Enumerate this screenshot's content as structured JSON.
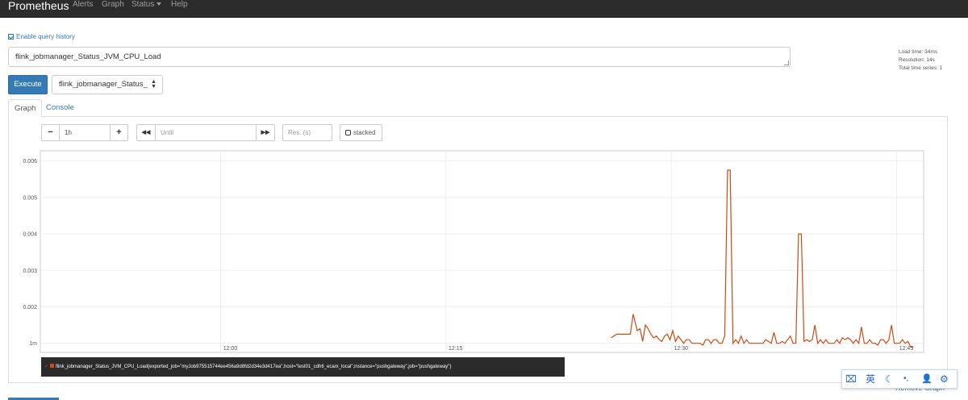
{
  "navbar": {
    "brand": "Prometheus",
    "items": [
      {
        "label": "Alerts"
      },
      {
        "label": "Graph"
      },
      {
        "label": "Status"
      },
      {
        "label": "Help"
      }
    ]
  },
  "history": {
    "label": "Enable query history"
  },
  "query": {
    "value": "flink_jobmanager_Status_JVM_CPU_Load"
  },
  "stats": {
    "load_time": "Load time: 34ms",
    "resolution": "Resolution: 14s",
    "total_series": "Total time series: 1"
  },
  "execute": {
    "label": "Execute"
  },
  "metric_select": {
    "value": "flink_jobmanager_Status_"
  },
  "tabs": [
    {
      "label": "Graph"
    },
    {
      "label": "Console"
    }
  ],
  "controls": {
    "minus": "−",
    "range": "1h",
    "plus": "+",
    "back": "◀◀",
    "until_placeholder": "Until",
    "forward": "▶▶",
    "res_placeholder": "Res. (s)",
    "stacked": "stacked"
  },
  "legend": {
    "series": "flink_jobmanager_Status_JVM_CPU_Load{exported_job=\"myJob975515744ee456a9d8fd2d34e3d417ea\",host=\"test01_cdh6_ecarx_local\",instance=\"pushgateway\",job=\"pushgateway\"}"
  },
  "remove_graph": "Remove Graph",
  "ime": {
    "lang": "英",
    "items": [
      "⌧",
      "☾",
      "•,",
      "👤",
      "⚙"
    ]
  },
  "colors": {
    "series": "#cb4b16",
    "accent": "#337ab7",
    "navbar": "#2c2c2c"
  },
  "chart_data": {
    "type": "line",
    "yticks": [
      {
        "label": "1m",
        "value": 0.001
      },
      {
        "label": "0.002",
        "value": 0.002
      },
      {
        "label": "0.003",
        "value": 0.003
      },
      {
        "label": "0.004",
        "value": 0.004
      },
      {
        "label": "0.005",
        "value": 0.005
      },
      {
        "label": "0.006",
        "value": 0.006
      }
    ],
    "xticks": [
      {
        "label": "12:00",
        "t": 12.0
      },
      {
        "label": "12:15",
        "t": 12.25
      },
      {
        "label": "12:30",
        "t": 12.5
      },
      {
        "label": "12:45",
        "t": 12.75
      }
    ],
    "xlim": [
      11.8,
      12.78
    ],
    "ylim": [
      0.00075,
      0.00628
    ],
    "series": [
      {
        "color": "#cb4b16",
        "points": [
          [
            12.4333,
            0.00115
          ],
          [
            12.4395,
            0.00125
          ],
          [
            12.4486,
            0.00125
          ],
          [
            12.4546,
            0.00125
          ],
          [
            12.4577,
            0.0018
          ],
          [
            12.4622,
            0.00135
          ],
          [
            12.4653,
            0.0014
          ],
          [
            12.4683,
            0.00105
          ],
          [
            12.4713,
            0.0015
          ],
          [
            12.4744,
            0.0014
          ],
          [
            12.4774,
            0.00125
          ],
          [
            12.4804,
            0.00115
          ],
          [
            12.4835,
            0.0012
          ],
          [
            12.4865,
            0.0011
          ],
          [
            12.4895,
            0.00105
          ],
          [
            12.4926,
            0.0012
          ],
          [
            12.4956,
            0.00125
          ],
          [
            12.4986,
            0.0011
          ],
          [
            12.5017,
            0.00135
          ],
          [
            12.5047,
            0.00105
          ],
          [
            12.5077,
            0.0012
          ],
          [
            12.5108,
            0.0011
          ],
          [
            12.5138,
            0.001
          ],
          [
            12.5168,
            0.0011
          ],
          [
            12.5199,
            0.0011
          ],
          [
            12.5229,
            0.001
          ],
          [
            12.526,
            0.001
          ],
          [
            12.529,
            0.001
          ],
          [
            12.532,
            0.001
          ],
          [
            12.5351,
            0.00095
          ],
          [
            12.5381,
            0.0011
          ],
          [
            12.5411,
            0.0011
          ],
          [
            12.5442,
            0.001
          ],
          [
            12.5472,
            0.0011
          ],
          [
            12.5502,
            0.0011
          ],
          [
            12.5533,
            0.001
          ],
          [
            12.5563,
            0.001
          ],
          [
            12.5593,
            0.0012
          ],
          [
            12.5624,
            0.00575
          ],
          [
            12.5654,
            0.00575
          ],
          [
            12.5684,
            0.001
          ],
          [
            12.5715,
            0.0011
          ],
          [
            12.5745,
            0.001
          ],
          [
            12.5775,
            0.0012
          ],
          [
            12.5806,
            0.001
          ],
          [
            12.5836,
            0.0011
          ],
          [
            12.5866,
            0.001
          ],
          [
            12.5897,
            0.001
          ],
          [
            12.5927,
            0.001
          ],
          [
            12.5957,
            0.001
          ],
          [
            12.5988,
            0.001
          ],
          [
            12.6018,
            0.001
          ],
          [
            12.6048,
            0.0011
          ],
          [
            12.6079,
            0.00105
          ],
          [
            12.6109,
            0.001
          ],
          [
            12.6139,
            0.0013
          ],
          [
            12.617,
            0.001
          ],
          [
            12.62,
            0.001
          ],
          [
            12.623,
            0.00105
          ],
          [
            12.6261,
            0.001
          ],
          [
            12.6291,
            0.0011
          ],
          [
            12.6321,
            0.0012
          ],
          [
            12.6352,
            0.001
          ],
          [
            12.6382,
            0.001
          ],
          [
            12.6412,
            0.004
          ],
          [
            12.6443,
            0.004
          ],
          [
            12.6473,
            0.00105
          ],
          [
            12.6503,
            0.0011
          ],
          [
            12.6534,
            0.00105
          ],
          [
            12.6564,
            0.0011
          ],
          [
            12.6594,
            0.0015
          ],
          [
            12.6625,
            0.001
          ],
          [
            12.6655,
            0.0011
          ],
          [
            12.6685,
            0.001
          ],
          [
            12.6716,
            0.0011
          ],
          [
            12.6746,
            0.001
          ],
          [
            12.6776,
            0.001
          ],
          [
            12.6807,
            0.001
          ],
          [
            12.6837,
            0.0011
          ],
          [
            12.6868,
            0.001
          ],
          [
            12.6898,
            0.00115
          ],
          [
            12.6928,
            0.0011
          ],
          [
            12.6959,
            0.00115
          ],
          [
            12.6989,
            0.0011
          ],
          [
            12.7019,
            0.001
          ],
          [
            12.705,
            0.0011
          ],
          [
            12.708,
            0.001
          ],
          [
            12.711,
            0.00145
          ],
          [
            12.7141,
            0.001
          ],
          [
            12.7171,
            0.001
          ],
          [
            12.7201,
            0.0011
          ],
          [
            12.7232,
            0.001
          ],
          [
            12.7262,
            0.001
          ],
          [
            12.7292,
            0.00095
          ],
          [
            12.7323,
            0.0011
          ],
          [
            12.7353,
            0.0011
          ],
          [
            12.7383,
            0.001
          ],
          [
            12.7414,
            0.0011
          ],
          [
            12.7444,
            0.0015
          ],
          [
            12.7474,
            0.001
          ],
          [
            12.7505,
            0.001
          ],
          [
            12.7535,
            0.001
          ],
          [
            12.7565,
            0.0011
          ],
          [
            12.7596,
            0.001
          ],
          [
            12.7626,
            0.00105
          ],
          [
            12.7656,
            0.0009
          ],
          [
            12.7687,
            0.0009
          ]
        ]
      }
    ]
  }
}
